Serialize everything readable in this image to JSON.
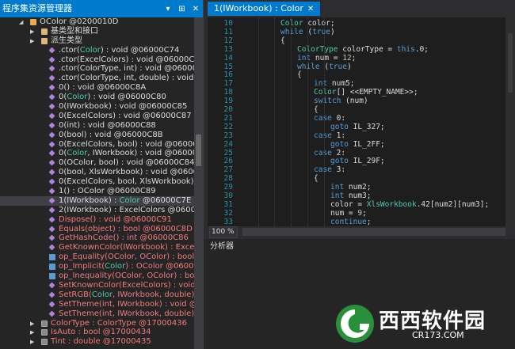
{
  "explorer": {
    "title": "程序集资源管理器",
    "buttons": [
      "▾",
      "⊞",
      "✕"
    ],
    "rows": [
      {
        "indent": 36,
        "arrow": "◢",
        "icon": "cls",
        "segs": [
          {
            "t": "OColor @0200010D",
            "c": "rest"
          }
        ]
      },
      {
        "indent": 50,
        "arrow": "▶",
        "icon": "folder",
        "segs": [
          {
            "t": "基类型和接口",
            "c": "rest"
          }
        ]
      },
      {
        "indent": 50,
        "arrow": "▶",
        "icon": "folder",
        "segs": [
          {
            "t": "派生类型",
            "c": "rest"
          }
        ]
      },
      {
        "indent": 60,
        "icon": "method",
        "segs": [
          {
            "t": ".ctor(",
            "c": "rest"
          },
          {
            "t": "Color",
            "c": "hl"
          },
          {
            "t": ") : void @06000C74",
            "c": "rest"
          }
        ]
      },
      {
        "indent": 60,
        "icon": "method",
        "segs": [
          {
            "t": ".ctor(ExcelColors) : void @06000C75",
            "c": "rest"
          }
        ]
      },
      {
        "indent": 60,
        "icon": "method",
        "segs": [
          {
            "t": ".ctor(ColorType, int) : void @06000C76",
            "c": "rest"
          }
        ]
      },
      {
        "indent": 60,
        "icon": "method",
        "segs": [
          {
            "t": ".ctor(ColorType, int, double) : void @0600",
            "c": "rest"
          }
        ]
      },
      {
        "indent": 60,
        "icon": "method",
        "segs": [
          {
            "t": "0() : void @06000C8A",
            "c": "rest"
          }
        ]
      },
      {
        "indent": 60,
        "icon": "method",
        "segs": [
          {
            "t": "0(",
            "c": "rest"
          },
          {
            "t": "Color",
            "c": "hl"
          },
          {
            "t": ") : void @06000C80",
            "c": "rest"
          }
        ]
      },
      {
        "indent": 60,
        "icon": "method",
        "segs": [
          {
            "t": "0(IWorkbook) : void @06000C85",
            "c": "rest"
          }
        ]
      },
      {
        "indent": 60,
        "icon": "method",
        "segs": [
          {
            "t": "0(ExcelColors) : void @06000C87",
            "c": "rest"
          }
        ]
      },
      {
        "indent": 60,
        "icon": "method",
        "segs": [
          {
            "t": "0(int) : void @06000C88",
            "c": "rest"
          }
        ]
      },
      {
        "indent": 60,
        "icon": "method",
        "segs": [
          {
            "t": "0(bool) : void @06000C8B",
            "c": "rest"
          }
        ]
      },
      {
        "indent": 60,
        "icon": "method",
        "segs": [
          {
            "t": "0(ExcelColors, bool) : void @06000C7C",
            "c": "rest"
          }
        ]
      },
      {
        "indent": 60,
        "icon": "method",
        "segs": [
          {
            "t": "0(",
            "c": "rest"
          },
          {
            "t": "Color",
            "c": "hl"
          },
          {
            "t": ", IWorkbook) : void @06000C7F",
            "c": "rest"
          }
        ]
      },
      {
        "indent": 60,
        "icon": "method",
        "segs": [
          {
            "t": "0(OColor, bool) : void @06000C84",
            "c": "rest"
          }
        ]
      },
      {
        "indent": 60,
        "icon": "method",
        "segs": [
          {
            "t": "0(bool, XlsWorkbook) : void @06000C80",
            "c": "rest"
          }
        ]
      },
      {
        "indent": 60,
        "icon": "method",
        "segs": [
          {
            "t": "0(ExcelColors, bool, XlsWorkbook) : void",
            "c": "rest"
          }
        ]
      },
      {
        "indent": 60,
        "icon": "method",
        "segs": [
          {
            "t": "1() : OColor @06000C89",
            "c": "rest"
          }
        ]
      },
      {
        "indent": 60,
        "icon": "method",
        "sel": true,
        "segs": [
          {
            "t": "1(IWorkbook) : ",
            "c": "rest"
          },
          {
            "t": "Color",
            "c": "hl"
          },
          {
            "t": " @06000C7E",
            "c": "rest"
          }
        ]
      },
      {
        "indent": 60,
        "icon": "method",
        "segs": [
          {
            "t": "2(IWorkbook) : ExcelColors @06000C79",
            "c": "rest"
          }
        ]
      },
      {
        "indent": 60,
        "icon": "method",
        "segs": [
          {
            "t": "Dispose() : void @06000C91",
            "c": "m"
          }
        ]
      },
      {
        "indent": 60,
        "icon": "method",
        "segs": [
          {
            "t": "Equals(object) : bool @06000C8D",
            "c": "m"
          }
        ]
      },
      {
        "indent": 60,
        "icon": "method",
        "segs": [
          {
            "t": "GetHashCode() : int @06000C86",
            "c": "m"
          }
        ]
      },
      {
        "indent": 60,
        "icon": "method",
        "segs": [
          {
            "t": "GetKnownColor(IWorkbook) : ExcelColors",
            "c": "m"
          }
        ]
      },
      {
        "indent": 60,
        "icon": "op",
        "segs": [
          {
            "t": "op_Equality(OColor, OColor) : bool @060",
            "c": "m"
          }
        ]
      },
      {
        "indent": 60,
        "icon": "op",
        "segs": [
          {
            "t": "op_Implicit(",
            "c": "m"
          },
          {
            "t": "Color",
            "c": "hl"
          },
          {
            "t": ") : OColor @06000C81",
            "c": "m"
          }
        ]
      },
      {
        "indent": 60,
        "icon": "op",
        "segs": [
          {
            "t": "op_Inequality(OColor, OColor) : bool @0",
            "c": "m"
          }
        ]
      },
      {
        "indent": 60,
        "icon": "method",
        "segs": [
          {
            "t": "SetKnownColor(ExcelColors) : void @060",
            "c": "m"
          }
        ]
      },
      {
        "indent": 60,
        "icon": "method",
        "segs": [
          {
            "t": "SetRGB(",
            "c": "m"
          },
          {
            "t": "Color",
            "c": "hl"
          },
          {
            "t": ", IWorkbook, double) : void",
            "c": "m"
          }
        ]
      },
      {
        "indent": 60,
        "icon": "method",
        "segs": [
          {
            "t": "SetTheme(int, IWorkbook) : void @0600",
            "c": "m"
          }
        ]
      },
      {
        "indent": 60,
        "icon": "method",
        "segs": [
          {
            "t": "SetTheme(int, IWorkbook, double) : void",
            "c": "m"
          }
        ]
      },
      {
        "indent": 50,
        "arrow": "▶",
        "icon": "prop",
        "segs": [
          {
            "t": "ColorType : ColorType @17000436",
            "c": "m"
          }
        ]
      },
      {
        "indent": 50,
        "arrow": "▶",
        "icon": "prop",
        "segs": [
          {
            "t": "IsAuto : bool @17000434",
            "c": "m"
          }
        ]
      },
      {
        "indent": 50,
        "arrow": "▶",
        "icon": "prop",
        "segs": [
          {
            "t": "Tint : double @17000435",
            "c": "m"
          }
        ]
      }
    ]
  },
  "tab": {
    "label": "1(IWorkbook) : Color",
    "close": "✕"
  },
  "code": {
    "lines": [
      {
        "n": "10",
        "x": 0,
        "segs": [
          {
            "t": "Color",
            "c": "ty"
          },
          {
            "t": " color;",
            "c": "pl"
          }
        ]
      },
      {
        "n": "11",
        "x": 0,
        "segs": [
          {
            "t": "while",
            "c": "kw"
          },
          {
            "t": " (",
            "c": "pl"
          },
          {
            "t": "true",
            "c": "kw"
          },
          {
            "t": ")",
            "c": "pl"
          }
        ]
      },
      {
        "n": "12",
        "x": 0,
        "segs": [
          {
            "t": "{",
            "c": "pl"
          }
        ]
      },
      {
        "n": "13",
        "x": 1,
        "segs": [
          {
            "t": "ColorType",
            "c": "ty"
          },
          {
            "t": " colorType = ",
            "c": "pl"
          },
          {
            "t": "this",
            "c": "kw"
          },
          {
            "t": ".0;",
            "c": "pl"
          }
        ]
      },
      {
        "n": "14",
        "x": 1,
        "segs": [
          {
            "t": "int",
            "c": "kw"
          },
          {
            "t": " num = ",
            "c": "pl"
          },
          {
            "t": "12",
            "c": "nu"
          },
          {
            "t": ";",
            "c": "pl"
          }
        ]
      },
      {
        "n": "15",
        "x": 1,
        "segs": [
          {
            "t": "while",
            "c": "kw"
          },
          {
            "t": " (",
            "c": "pl"
          },
          {
            "t": "true",
            "c": "kw"
          },
          {
            "t": ")",
            "c": "pl"
          }
        ]
      },
      {
        "n": "16",
        "x": 1,
        "segs": [
          {
            "t": "{",
            "c": "pl"
          }
        ]
      },
      {
        "n": "17",
        "x": 2,
        "segs": [
          {
            "t": "int",
            "c": "kw"
          },
          {
            "t": " num5;",
            "c": "pl"
          }
        ]
      },
      {
        "n": "18",
        "x": 2,
        "segs": [
          {
            "t": "Color",
            "c": "ty"
          },
          {
            "t": "[] <<EMPTY_NAME>>;",
            "c": "pl"
          }
        ]
      },
      {
        "n": "19",
        "x": 2,
        "segs": [
          {
            "t": "switch",
            "c": "kw"
          },
          {
            "t": " (num)",
            "c": "pl"
          }
        ]
      },
      {
        "n": "20",
        "x": 2,
        "segs": [
          {
            "t": "{",
            "c": "pl"
          }
        ]
      },
      {
        "n": "21",
        "x": 2,
        "segs": [
          {
            "t": "case",
            "c": "kw"
          },
          {
            "t": " 0:",
            "c": "pl"
          }
        ]
      },
      {
        "n": "22",
        "x": 3,
        "segs": [
          {
            "t": "goto",
            "c": "kw"
          },
          {
            "t": " IL_327;",
            "c": "pl"
          }
        ]
      },
      {
        "n": "23",
        "x": 2,
        "segs": [
          {
            "t": "case",
            "c": "kw"
          },
          {
            "t": " 1:",
            "c": "pl"
          }
        ]
      },
      {
        "n": "24",
        "x": 3,
        "segs": [
          {
            "t": "goto",
            "c": "kw"
          },
          {
            "t": " IL_2FF;",
            "c": "pl"
          }
        ]
      },
      {
        "n": "25",
        "x": 2,
        "segs": [
          {
            "t": "case",
            "c": "kw"
          },
          {
            "t": " 2:",
            "c": "pl"
          }
        ]
      },
      {
        "n": "26",
        "x": 3,
        "segs": [
          {
            "t": "goto",
            "c": "kw"
          },
          {
            "t": " IL_29F;",
            "c": "pl"
          }
        ]
      },
      {
        "n": "27",
        "x": 2,
        "segs": [
          {
            "t": "case",
            "c": "kw"
          },
          {
            "t": " 3:",
            "c": "pl"
          }
        ]
      },
      {
        "n": "28",
        "x": 2,
        "segs": [
          {
            "t": "{",
            "c": "pl"
          }
        ]
      },
      {
        "n": "29",
        "x": 3,
        "segs": [
          {
            "t": "int",
            "c": "kw"
          },
          {
            "t": " num2;",
            "c": "pl"
          }
        ]
      },
      {
        "n": "30",
        "x": 3,
        "segs": [
          {
            "t": "int",
            "c": "kw"
          },
          {
            "t": " num3;",
            "c": "pl"
          }
        ]
      },
      {
        "n": "31",
        "x": 3,
        "segs": [
          {
            "t": "color = ",
            "c": "pl"
          },
          {
            "t": "XlsWorkbook",
            "c": "ty"
          },
          {
            "t": ".42[num2][num3];",
            "c": "pl"
          }
        ]
      },
      {
        "n": "32",
        "x": 3,
        "segs": [
          {
            "t": "num = ",
            "c": "pl"
          },
          {
            "t": "9",
            "c": "nu"
          },
          {
            "t": ";",
            "c": "pl"
          }
        ]
      },
      {
        "n": "33",
        "x": 3,
        "segs": [
          {
            "t": "continue",
            "c": "kw"
          },
          {
            "t": ";",
            "c": "pl"
          }
        ]
      }
    ]
  },
  "zoom": "100 %",
  "analyzer": {
    "title": "分析器"
  },
  "watermark": {
    "brand": "西西软件园",
    "url": "CR173.COM"
  }
}
